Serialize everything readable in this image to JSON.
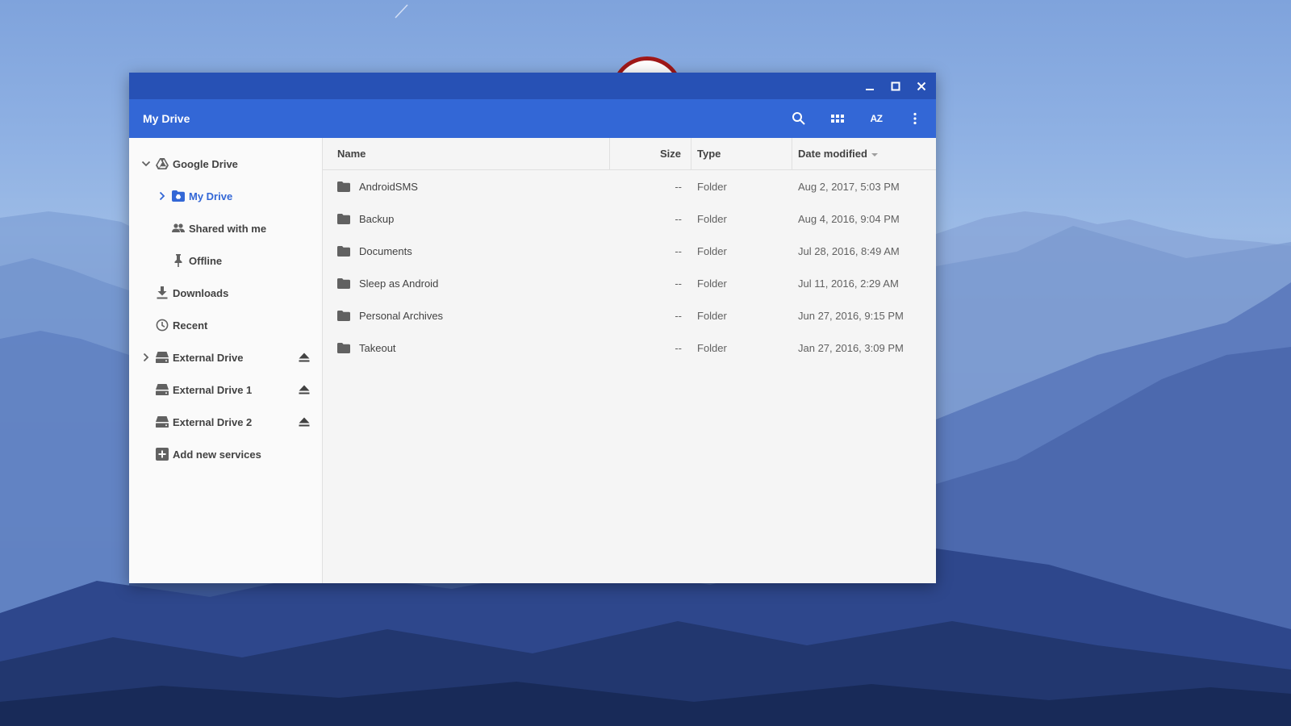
{
  "window": {
    "title": "My Drive",
    "controls": {
      "minimize_icon": "minimize-icon",
      "maximize_icon": "maximize-icon",
      "close_icon": "close-icon"
    }
  },
  "toolbar": {
    "title": "My Drive",
    "actions": [
      "search-icon",
      "grid-view-icon",
      "sort-icon",
      "more-vert-icon"
    ],
    "sort_label": "AZ"
  },
  "sidebar": {
    "items": [
      {
        "label": "Google Drive",
        "icon": "google-drive-icon",
        "level": 0,
        "expander": "expanded",
        "active": false,
        "eject": false
      },
      {
        "label": "My Drive",
        "icon": "my-drive-icon",
        "level": 1,
        "expander": "collapsed",
        "active": true,
        "eject": false
      },
      {
        "label": "Shared with me",
        "icon": "shared-people-icon",
        "level": 1,
        "expander": "none",
        "active": false,
        "eject": false
      },
      {
        "label": "Offline",
        "icon": "pin-icon",
        "level": 1,
        "expander": "none",
        "active": false,
        "eject": false
      },
      {
        "label": "Downloads",
        "icon": "download-icon",
        "level": 0,
        "expander": "none",
        "active": false,
        "eject": false
      },
      {
        "label": "Recent",
        "icon": "clock-icon",
        "level": 0,
        "expander": "none",
        "active": false,
        "eject": false
      },
      {
        "label": "External Drive",
        "icon": "drive-icon",
        "level": 0,
        "expander": "collapsed",
        "active": false,
        "eject": true
      },
      {
        "label": "External Drive 1",
        "icon": "drive-icon",
        "level": 0,
        "expander": "none",
        "active": false,
        "eject": true
      },
      {
        "label": "External Drive 2",
        "icon": "drive-icon",
        "level": 0,
        "expander": "none",
        "active": false,
        "eject": true
      },
      {
        "label": "Add new services",
        "icon": "add-box-icon",
        "level": 0,
        "expander": "none",
        "active": false,
        "eject": false
      }
    ]
  },
  "file_list": {
    "columns": {
      "name": "Name",
      "size": "Size",
      "type": "Type",
      "date": "Date modified"
    },
    "sort": {
      "column": "date",
      "direction": "descending"
    },
    "rows": [
      {
        "name": "AndroidSMS",
        "size": "--",
        "type": "Folder",
        "date": "Aug 2, 2017, 5:03 PM"
      },
      {
        "name": "Backup",
        "size": "--",
        "type": "Folder",
        "date": "Aug 4, 2016, 9:04 PM"
      },
      {
        "name": "Documents",
        "size": "--",
        "type": "Folder",
        "date": "Jul 28, 2016, 8:49 AM"
      },
      {
        "name": "Sleep as Android",
        "size": "--",
        "type": "Folder",
        "date": "Jul 11, 2016, 2:29 AM"
      },
      {
        "name": "Personal Archives",
        "size": "--",
        "type": "Folder",
        "date": "Jun 27, 2016, 9:15 PM"
      },
      {
        "name": "Takeout",
        "size": "--",
        "type": "Folder",
        "date": "Jan 27, 2016, 3:09 PM"
      }
    ]
  },
  "colors": {
    "frame": "#2751b5",
    "toolbar": "#3367d6",
    "accent": "#3367d6",
    "sidebar_bg": "#fafafa",
    "list_bg": "#f5f5f5",
    "text": "#424242",
    "icon": "#616161"
  }
}
